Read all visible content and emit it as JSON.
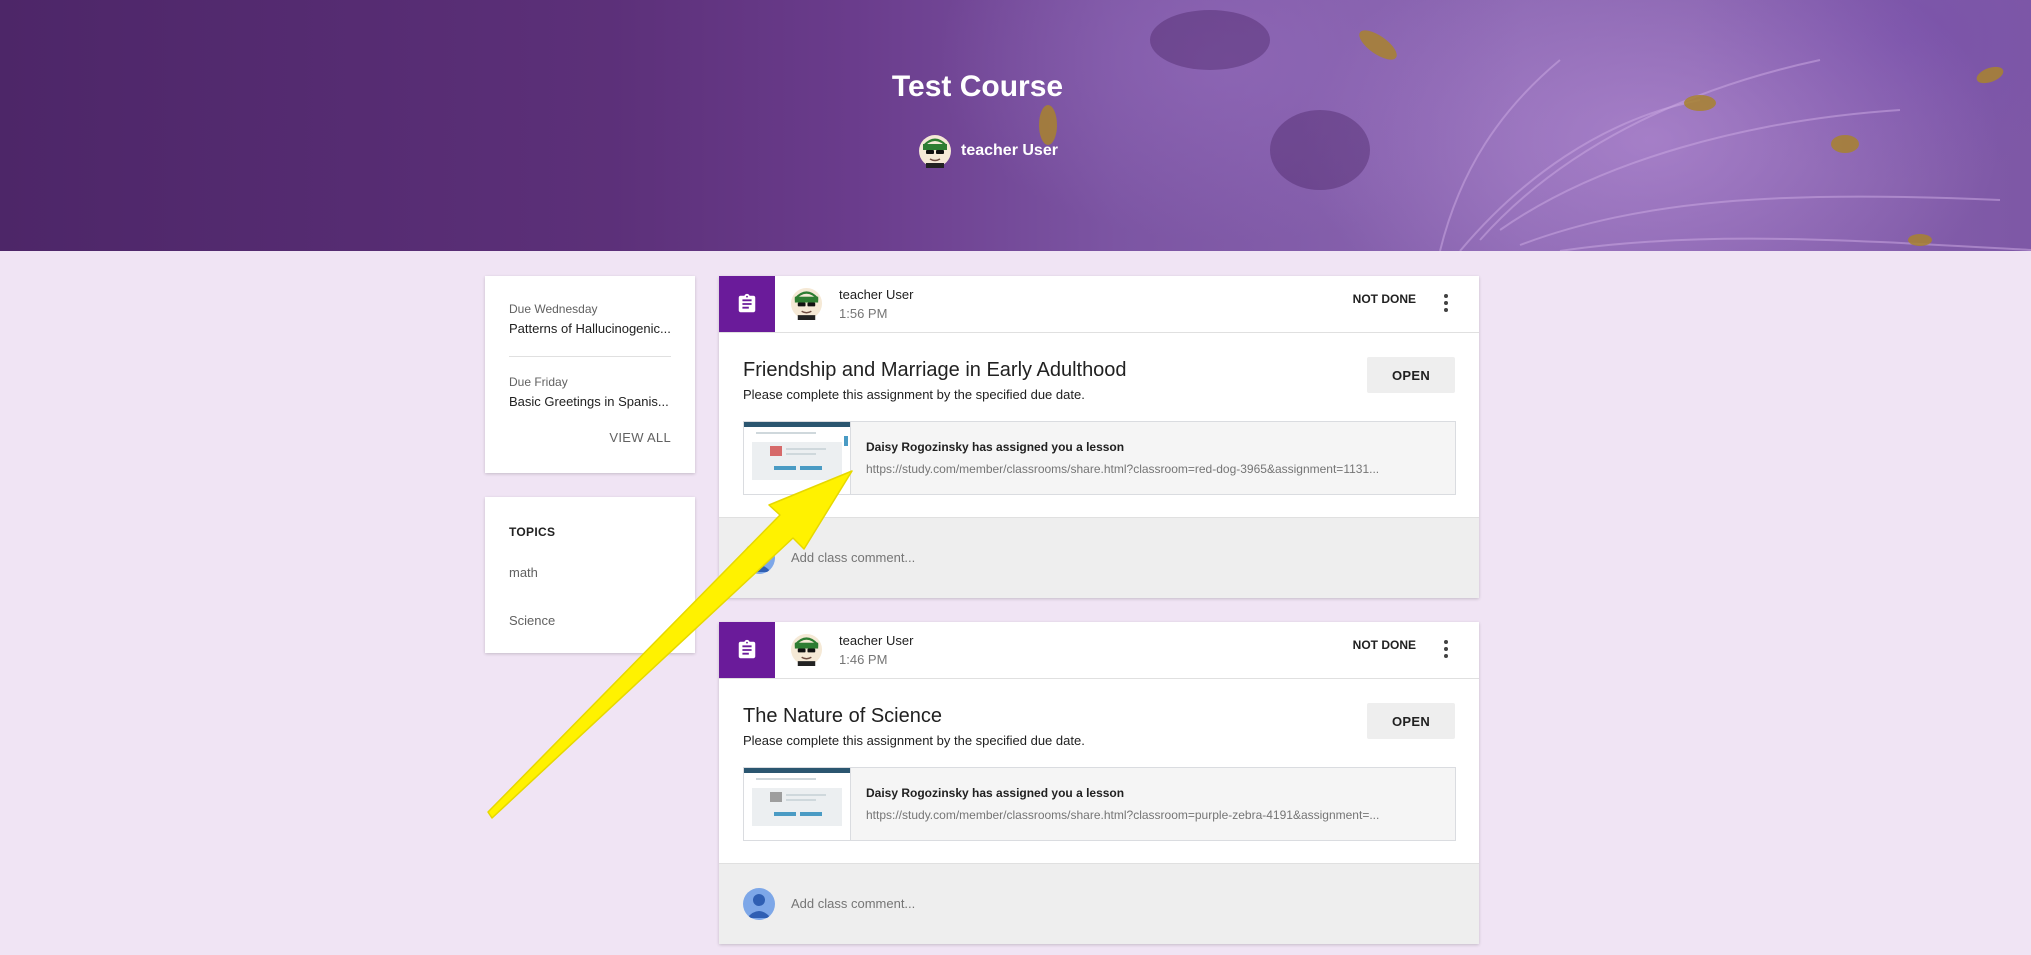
{
  "course": {
    "title": "Test Course",
    "teacher": "teacher User"
  },
  "upcoming": {
    "items": [
      {
        "due": "Due Wednesday",
        "title": "Patterns of Hallucinogenic..."
      },
      {
        "due": "Due Friday",
        "title": "Basic Greetings in Spanis..."
      }
    ],
    "view_all": "VIEW ALL"
  },
  "topics": {
    "heading": "TOPICS",
    "items": [
      "math",
      "Science"
    ]
  },
  "posts": [
    {
      "author": "teacher User",
      "time": "1:56 PM",
      "status": "NOT DONE",
      "title": "Friendship and Marriage in Early Adulthood",
      "description": "Please complete this assignment by the specified due date.",
      "open_label": "OPEN",
      "attachment": {
        "title": "Daisy Rogozinsky has assigned you a lesson",
        "url": "https://study.com/member/classrooms/share.html?classroom=red-dog-3965&assignment=1131..."
      },
      "comment_placeholder": "Add class comment..."
    },
    {
      "author": "teacher User",
      "time": "1:46 PM",
      "status": "NOT DONE",
      "title": "The Nature of Science",
      "description": "Please complete this assignment by the specified due date.",
      "open_label": "OPEN",
      "attachment": {
        "title": "Daisy Rogozinsky has assigned you a lesson",
        "url": "https://study.com/member/classrooms/share.html?classroom=purple-zebra-4191&assignment=..."
      },
      "comment_placeholder": "Add class comment..."
    }
  ],
  "colors": {
    "accent": "#6a1b9a",
    "page_background": "#f0e4f4",
    "annotation_arrow": "#fff200"
  }
}
